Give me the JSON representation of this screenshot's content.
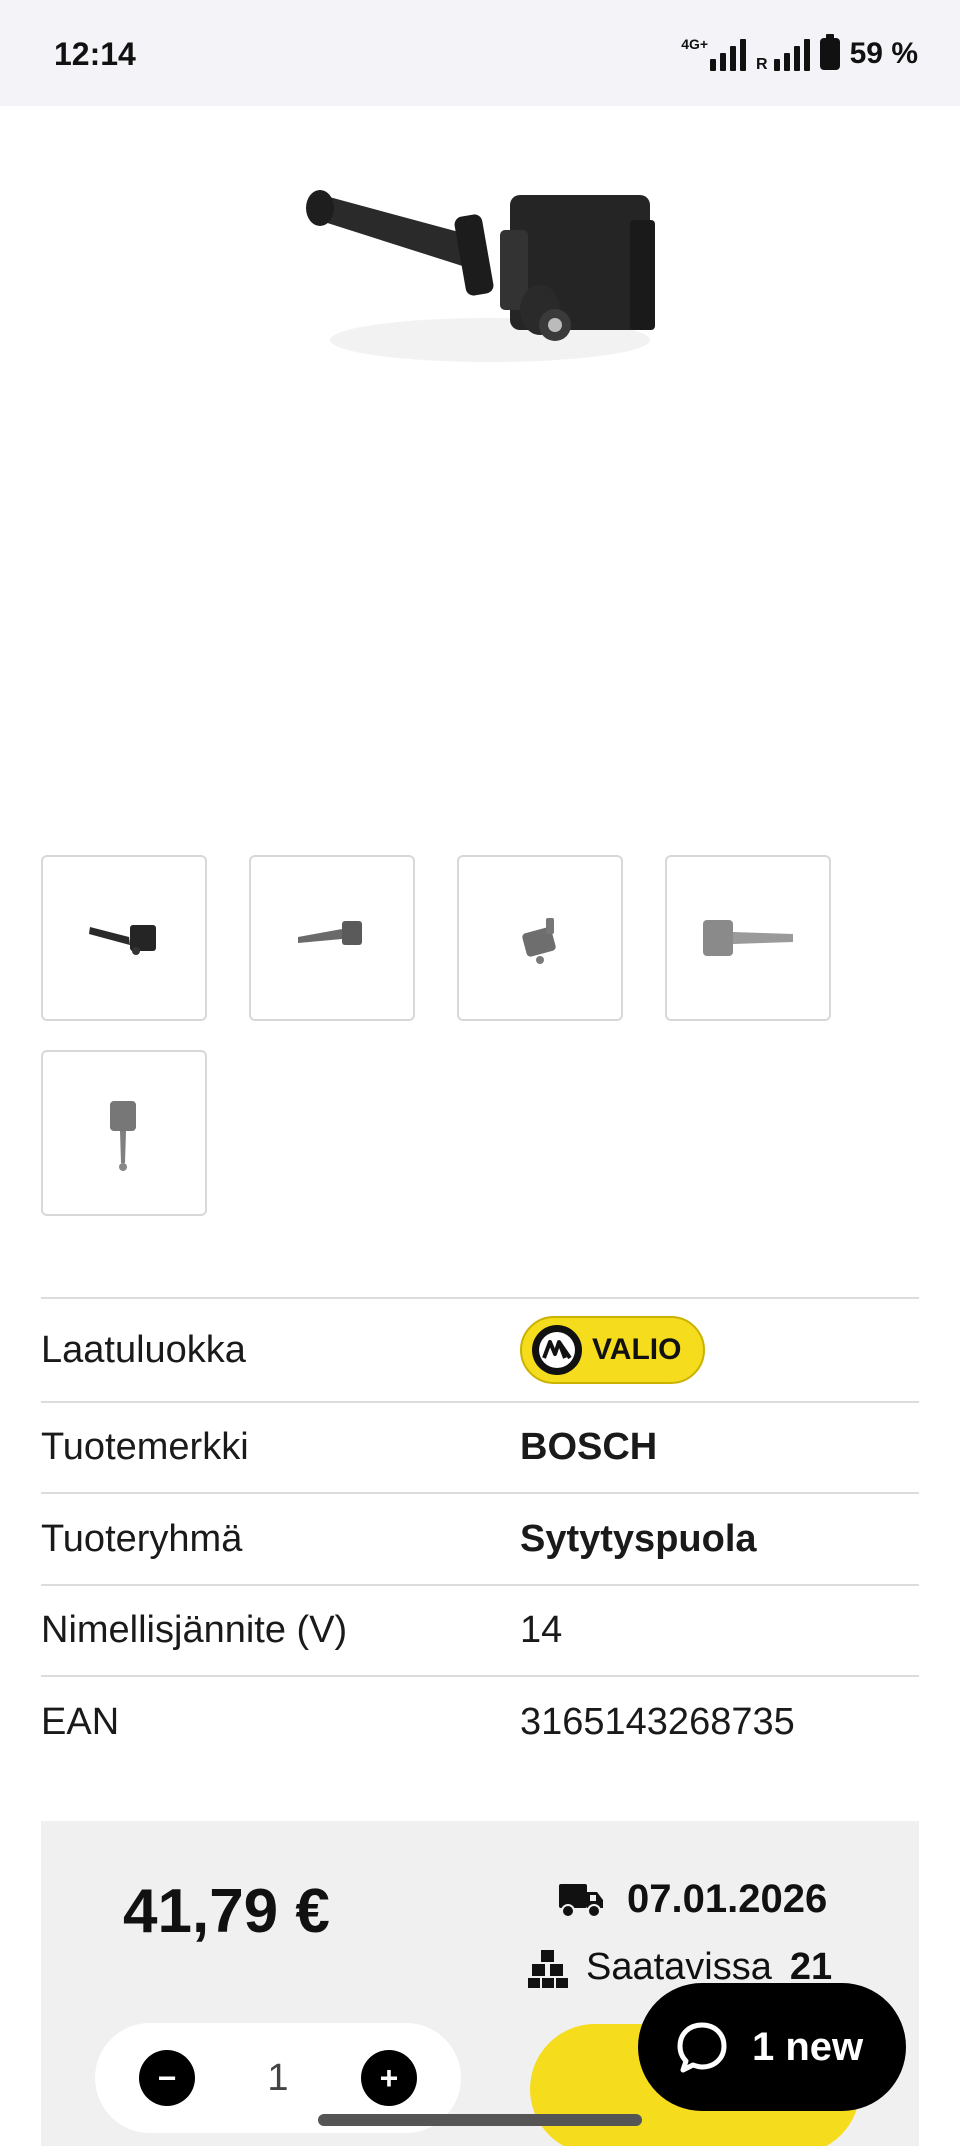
{
  "status_bar": {
    "time": "12:14",
    "network": "4G+",
    "roaming": "R",
    "battery": "59 %"
  },
  "product_images": {
    "main_icon": "ignition-coil-image",
    "thumbnails": [
      "ignition-coil-side-view",
      "ignition-coil-angle-view",
      "ignition-coil-top-view",
      "ignition-coil-reverse-view",
      "ignition-coil-vertical-view"
    ]
  },
  "specs": [
    {
      "label": "Laatuluokka",
      "value": "VALIO",
      "type": "badge"
    },
    {
      "label": "Tuotemerkki",
      "value": "BOSCH",
      "type": "bold"
    },
    {
      "label": "Tuoteryhmä",
      "value": "Sytytyspuola",
      "type": "bold"
    },
    {
      "label": "Nimellisjännite (V)",
      "value": "14",
      "type": "plain"
    },
    {
      "label": "EAN",
      "value": "3165143268735",
      "type": "plain"
    }
  ],
  "purchase": {
    "price": "41,79 €",
    "delivery_date": "07.01.2026",
    "stock_label": "Saatavissa",
    "stock_count": "21",
    "quantity": "1",
    "minus": "−",
    "plus": "+"
  },
  "chat": {
    "label": "1 new"
  },
  "colors": {
    "accent_yellow": "#f5dc1c",
    "panel_gray": "#f0f0f0",
    "text": "#111111"
  }
}
